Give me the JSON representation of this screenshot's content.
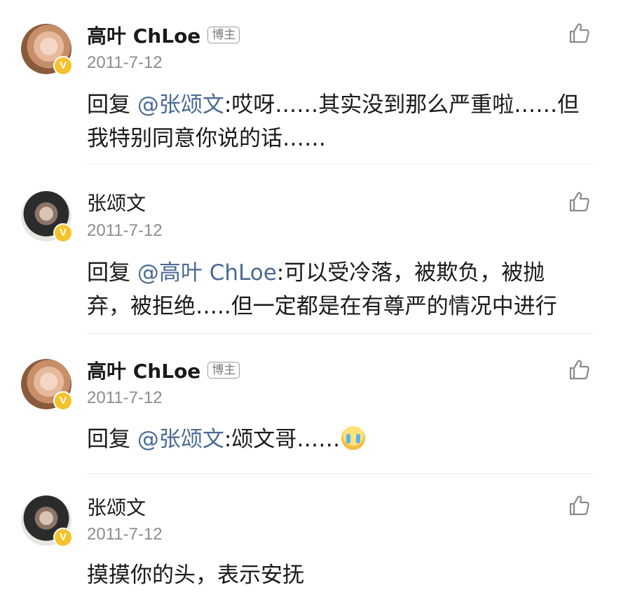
{
  "comments": [
    {
      "user": "高叶 ChLoe",
      "badge": "博主",
      "date": "2011-7-12",
      "reply_prefix": "回复 ",
      "mention": "@张颂文",
      "text": ":哎呀……其实没到那么严重啦……但我特别同意你说的话……"
    },
    {
      "user": "张颂文",
      "date": "2011-7-12",
      "reply_prefix": "回复 ",
      "mention": "@高叶 ChLoe",
      "text": ":可以受冷落，被欺负，被抛弃，被拒绝…..但一定都是在有尊严的情况中进行"
    },
    {
      "user": "高叶 ChLoe",
      "badge": "博主",
      "date": "2011-7-12",
      "reply_prefix": "回复 ",
      "mention": "@张颂文",
      "text": ":颂文哥……",
      "emoji": "crying-emoji"
    },
    {
      "user": "张颂文",
      "date": "2011-7-12",
      "text": "摸摸你的头，表示安抚"
    }
  ],
  "icons": {
    "like": "thumbs-up-outline-icon",
    "verified": "verified-v-badge-icon",
    "verified_letter": "V"
  },
  "colors": {
    "mention": "#4a6a95",
    "verified_badge": "#f5c22b",
    "date": "#8c8c8c"
  }
}
